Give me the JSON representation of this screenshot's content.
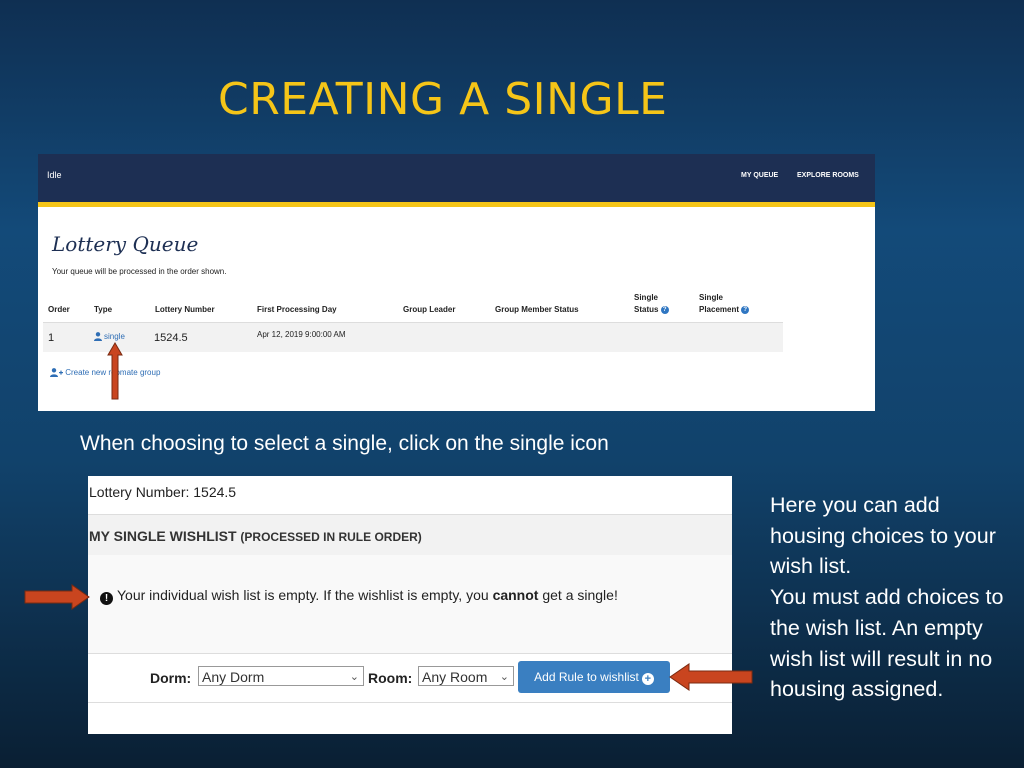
{
  "slide": {
    "title": "CREATING A SINGLE"
  },
  "screenshot1": {
    "status": "Idle",
    "nav": [
      "MY QUEUE",
      "EXPLORE ROOMS"
    ],
    "heading": "Lottery Queue",
    "subheading": "Your queue will be processed in the order shown.",
    "columns": {
      "order": "Order",
      "type": "Type",
      "lottery_number": "Lottery Number",
      "first_processing_day": "First Processing Day",
      "group_leader": "Group Leader",
      "group_member_status": "Group Member Status",
      "single_status_l1": "Single",
      "single_status_l2": "Status",
      "single_placement_l1": "Single",
      "single_placement_l2": "Placement"
    },
    "row": {
      "order": "1",
      "type": "single",
      "lottery_number": "1524.5",
      "first_processing_day": "Apr 12, 2019 9:00:00 AM"
    },
    "create_link": "Create new roomate group"
  },
  "caption": "When choosing to select a single, click on the single icon",
  "screenshot2": {
    "lottery_number": "Lottery Number: 1524.5",
    "wishlist_title": "MY SINGLE WISHLIST",
    "wishlist_subtitle": "(PROCESSED IN RULE ORDER)",
    "empty_msg_a": "Your individual wish list is empty. If the wishlist is empty, you ",
    "empty_msg_bold": "cannot",
    "empty_msg_b": " get a single!",
    "dorm_label": "Dorm:",
    "dorm_value": "Any Dorm",
    "room_label": "Room:",
    "room_value": "Any Room",
    "add_button": "Add Rule to wishlist"
  },
  "side_text": {
    "l1": "Here you can add",
    "l2": "housing choices to your",
    "l3": "wish list.",
    "l4": "You must add choices to",
    "l5": "the wish list.  An empty",
    "l6": "wish list will result in no",
    "l7": "housing assigned."
  },
  "colors": {
    "title": "#f5c518",
    "arrow": "#c9451f",
    "nav": "#1d2f53",
    "button": "#3a7fc1"
  }
}
